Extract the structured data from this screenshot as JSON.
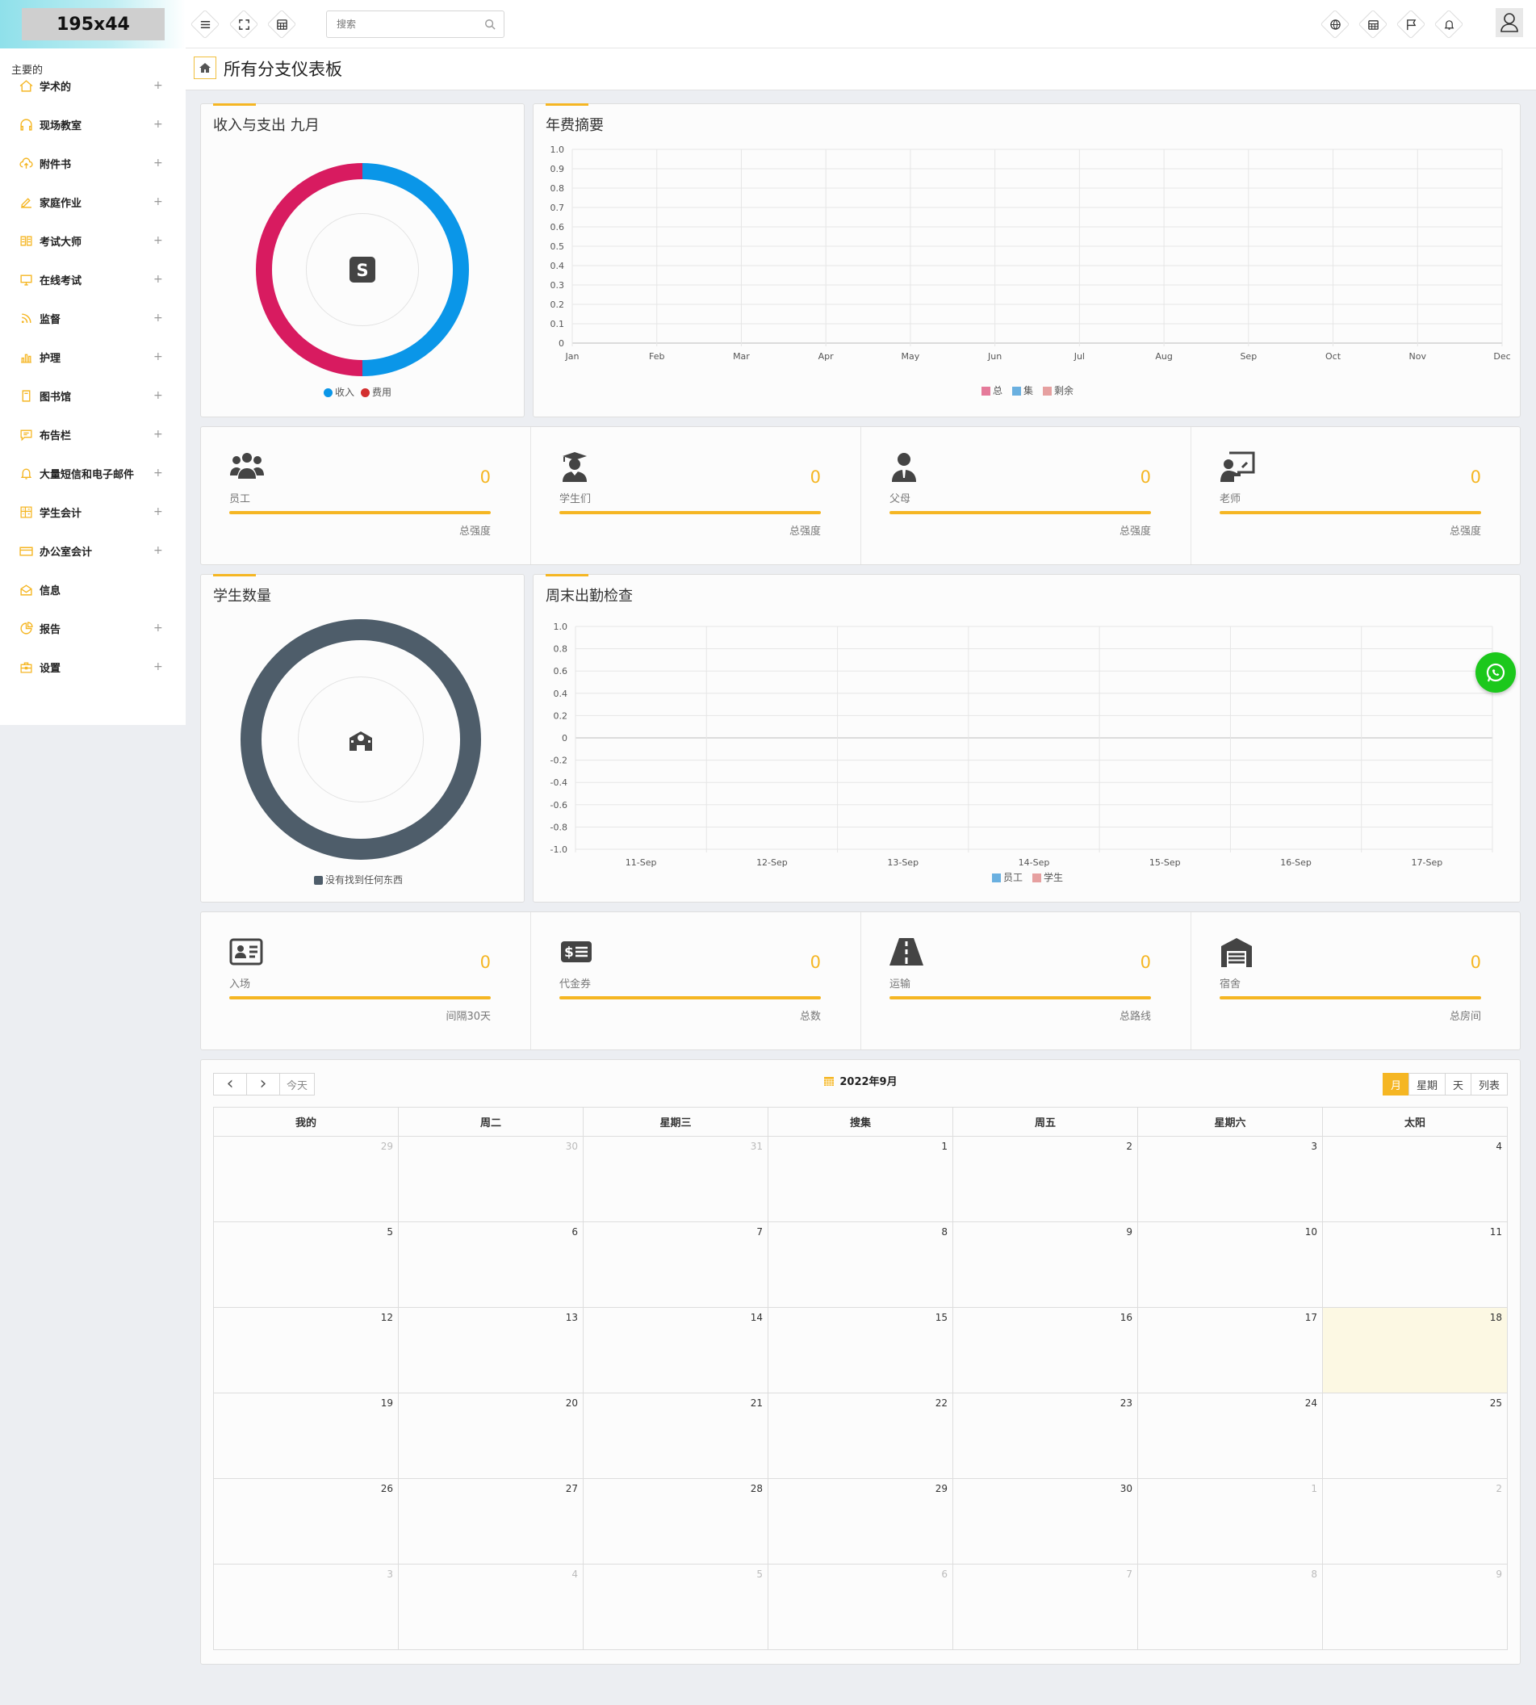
{
  "logo": {
    "text": "195x44"
  },
  "search": {
    "placeholder": "搜索"
  },
  "sidebar": {
    "heading": "主要的",
    "items": [
      {
        "label": "学术的",
        "icon": "home-icon",
        "expandable": true
      },
      {
        "label": "现场教室",
        "icon": "headset-icon",
        "expandable": true
      },
      {
        "label": "附件书",
        "icon": "cloud-upload-icon",
        "expandable": true
      },
      {
        "label": "家庭作业",
        "icon": "edit-icon",
        "expandable": true
      },
      {
        "label": "考试大师",
        "icon": "book-icon",
        "expandable": true
      },
      {
        "label": "在线考试",
        "icon": "monitor-icon",
        "expandable": true
      },
      {
        "label": "监督",
        "icon": "rss-icon",
        "expandable": true
      },
      {
        "label": "护理",
        "icon": "bar-chart-icon",
        "expandable": true
      },
      {
        "label": "图书馆",
        "icon": "notebook-icon",
        "expandable": true
      },
      {
        "label": "布告栏",
        "icon": "message-icon",
        "expandable": true
      },
      {
        "label": "大量短信和电子邮件",
        "icon": "bell-icon",
        "expandable": true
      },
      {
        "label": "学生会计",
        "icon": "calculator-icon",
        "expandable": true
      },
      {
        "label": "办公室会计",
        "icon": "credit-card-icon",
        "expandable": true
      },
      {
        "label": "信息",
        "icon": "mail-icon",
        "expandable": false
      },
      {
        "label": "报告",
        "icon": "pie-chart-icon",
        "expandable": true
      },
      {
        "label": "设置",
        "icon": "briefcase-icon",
        "expandable": true
      }
    ],
    "plus": "+"
  },
  "page": {
    "title": "所有分支仪表板"
  },
  "income_card": {
    "title": "收入与支出 九月",
    "legend": [
      {
        "label": "收入",
        "color": "#0a96e8"
      },
      {
        "label": "费用",
        "color": "#d81b60"
      }
    ]
  },
  "fee_card": {
    "title": "年费摘要"
  },
  "stats_row1": [
    {
      "icon": "users-icon",
      "value": "0",
      "label": "员工",
      "sub": "总强度"
    },
    {
      "icon": "graduate-icon",
      "value": "0",
      "label": "学生们",
      "sub": "总强度"
    },
    {
      "icon": "parent-icon",
      "value": "0",
      "label": "父母",
      "sub": "总强度"
    },
    {
      "icon": "teacher-icon",
      "value": "0",
      "label": "老师",
      "sub": "总强度"
    }
  ],
  "students_card": {
    "title": "学生数量",
    "legend": "没有找到任何东西",
    "color": "#4e5d6a"
  },
  "attendance_card": {
    "title": "周末出勤检查"
  },
  "stats_row2": [
    {
      "icon": "id-card-icon",
      "value": "0",
      "label": "入场",
      "sub": "间隔30天"
    },
    {
      "icon": "voucher-icon",
      "value": "0",
      "label": "代金券",
      "sub": "总数"
    },
    {
      "icon": "road-icon",
      "value": "0",
      "label": "运输",
      "sub": "总路线"
    },
    {
      "icon": "warehouse-icon",
      "value": "0",
      "label": "宿舍",
      "sub": "总房间"
    }
  ],
  "calendar": {
    "title": "2022年9月",
    "prev": "‹",
    "next": "›",
    "today": "今天",
    "views": [
      {
        "label": "月",
        "active": true
      },
      {
        "label": "星期",
        "active": false
      },
      {
        "label": "天",
        "active": false
      },
      {
        "label": "列表",
        "active": false
      }
    ],
    "weekdays": [
      "我的",
      "周二",
      "星期三",
      "搜集",
      "周五",
      "星期六",
      "太阳"
    ],
    "weeks": [
      [
        {
          "d": "29",
          "o": true
        },
        {
          "d": "30",
          "o": true
        },
        {
          "d": "31",
          "o": true
        },
        {
          "d": "1"
        },
        {
          "d": "2"
        },
        {
          "d": "3"
        },
        {
          "d": "4"
        }
      ],
      [
        {
          "d": "5"
        },
        {
          "d": "6"
        },
        {
          "d": "7"
        },
        {
          "d": "8"
        },
        {
          "d": "9"
        },
        {
          "d": "10"
        },
        {
          "d": "11"
        }
      ],
      [
        {
          "d": "12"
        },
        {
          "d": "13"
        },
        {
          "d": "14"
        },
        {
          "d": "15"
        },
        {
          "d": "16"
        },
        {
          "d": "17"
        },
        {
          "d": "18",
          "today": true
        }
      ],
      [
        {
          "d": "19"
        },
        {
          "d": "20"
        },
        {
          "d": "21"
        },
        {
          "d": "22"
        },
        {
          "d": "23"
        },
        {
          "d": "24"
        },
        {
          "d": "25"
        }
      ],
      [
        {
          "d": "26"
        },
        {
          "d": "27"
        },
        {
          "d": "28"
        },
        {
          "d": "29"
        },
        {
          "d": "30"
        },
        {
          "d": "1",
          "o": true
        },
        {
          "d": "2",
          "o": true
        }
      ],
      [
        {
          "d": "3",
          "o": true
        },
        {
          "d": "4",
          "o": true
        },
        {
          "d": "5",
          "o": true
        },
        {
          "d": "6",
          "o": true
        },
        {
          "d": "7",
          "o": true
        },
        {
          "d": "8",
          "o": true
        },
        {
          "d": "9",
          "o": true
        }
      ]
    ]
  },
  "colors": {
    "accent": "#f5b623",
    "income": "#0a96e8",
    "expense": "#d81b60",
    "whatsapp": "#1cc81c"
  },
  "chart_data": [
    {
      "type": "pie",
      "title": "收入与支出 九月",
      "categories": [
        "收入",
        "费用"
      ],
      "values": [
        50,
        50
      ],
      "colors": [
        "#0a96e8",
        "#d81b60"
      ]
    },
    {
      "type": "line",
      "title": "年费摘要",
      "categories": [
        "Jan",
        "Feb",
        "Mar",
        "Apr",
        "May",
        "Jun",
        "Jul",
        "Aug",
        "Sep",
        "Oct",
        "Nov",
        "Dec"
      ],
      "yticks": [
        "0",
        "0.1",
        "0.2",
        "0.3",
        "0.4",
        "0.5",
        "0.6",
        "0.7",
        "0.8",
        "0.9",
        "1.0"
      ],
      "ylim": [
        0,
        1
      ],
      "series": [
        {
          "name": "总",
          "values": [],
          "color": "#e57a9a"
        },
        {
          "name": "集",
          "values": [],
          "color": "#6ab0e0"
        },
        {
          "name": "剩余",
          "values": [],
          "color": "#e6a0a0"
        }
      ],
      "grid": true,
      "legend": "bottom"
    },
    {
      "type": "pie",
      "title": "学生数量",
      "categories": [
        "没有找到任何东西"
      ],
      "values": [
        1
      ],
      "colors": [
        "#4e5d6a"
      ]
    },
    {
      "type": "bar",
      "title": "周末出勤检查",
      "categories": [
        "11-Sep",
        "12-Sep",
        "13-Sep",
        "14-Sep",
        "15-Sep",
        "16-Sep",
        "17-Sep"
      ],
      "yticks": [
        "1.0",
        "0.8",
        "0.6",
        "0.4",
        "0.2",
        "0",
        "-0.2",
        "-0.4",
        "-0.6",
        "-0.8",
        "-1.0"
      ],
      "ylim": [
        -1,
        1
      ],
      "series": [
        {
          "name": "员工",
          "values": [],
          "color": "#6ab0e0"
        },
        {
          "name": "学生",
          "values": [],
          "color": "#e6a0a0"
        }
      ],
      "grid": true,
      "legend": "bottom"
    }
  ]
}
